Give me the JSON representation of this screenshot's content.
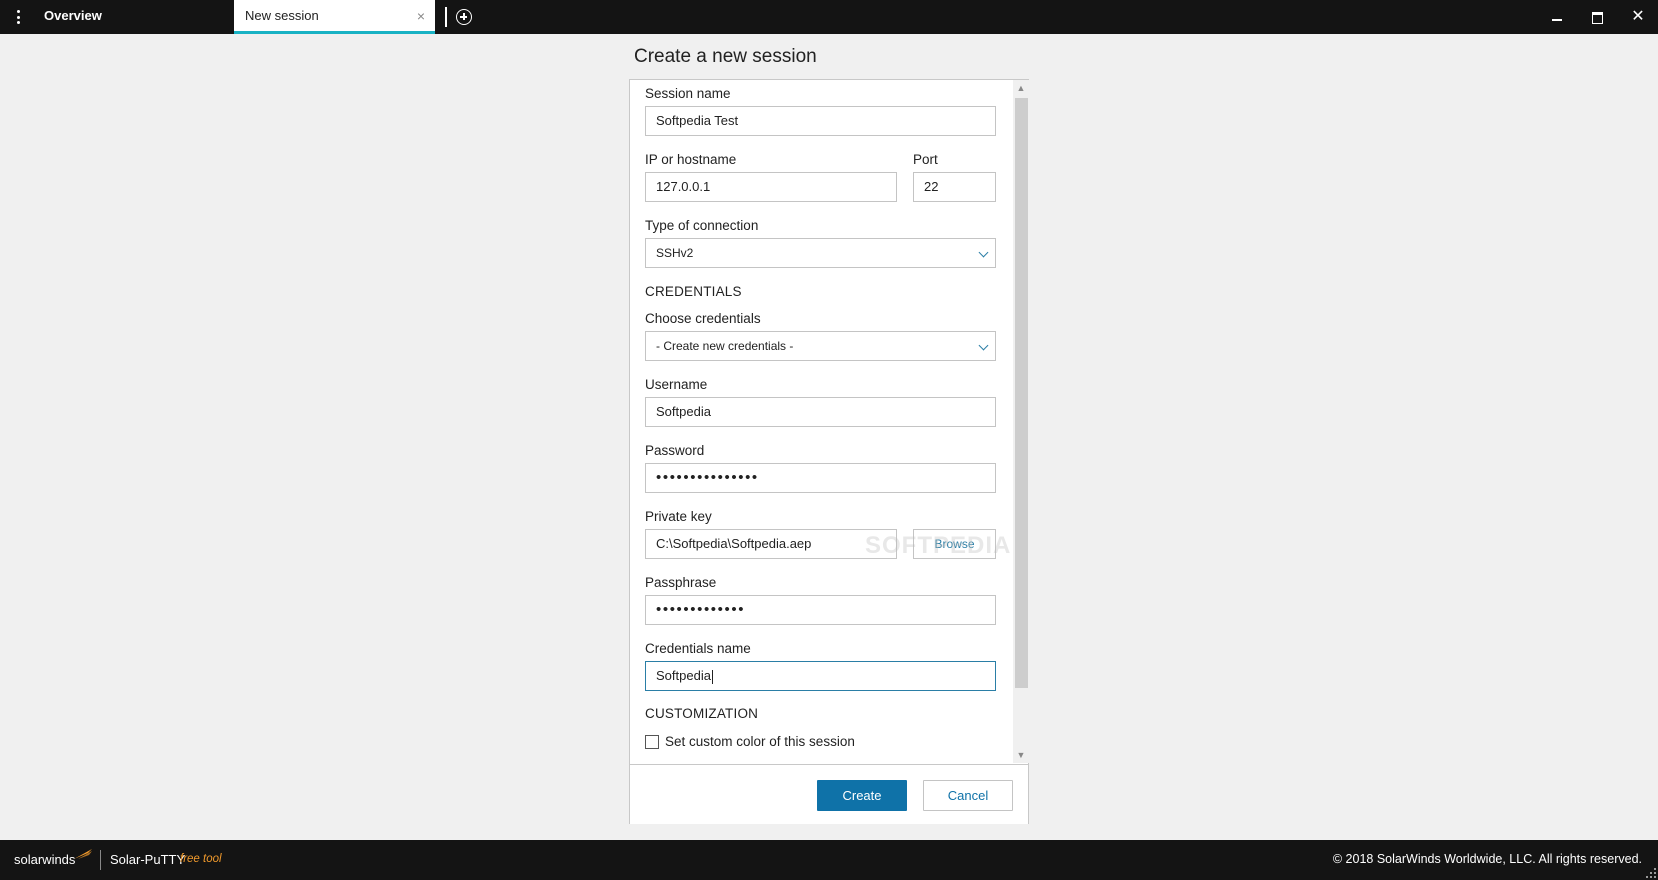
{
  "window": {
    "tabs": [
      {
        "label": "Overview"
      },
      {
        "label": "New session",
        "close": "×"
      }
    ],
    "close_glyph": "✕"
  },
  "dialog": {
    "title": "Create a new session",
    "session_name": {
      "label": "Session name",
      "value": "Softpedia Test"
    },
    "host": {
      "label": "IP or hostname",
      "value": "127.0.0.1"
    },
    "port": {
      "label": "Port",
      "value": "22"
    },
    "connection_type": {
      "label": "Type of connection",
      "value": "SSHv2"
    },
    "credentials_section": "CREDENTIALS",
    "choose_credentials": {
      "label": "Choose credentials",
      "value": "- Create new credentials -"
    },
    "username": {
      "label": "Username",
      "value": "Softpedia"
    },
    "password": {
      "label": "Password",
      "value": "•••••••••••••••"
    },
    "private_key": {
      "label": "Private key",
      "value": "C:\\Softpedia\\Softpedia.aep",
      "browse_label": "Browse"
    },
    "passphrase": {
      "label": "Passphrase",
      "value": "•••••••••••••"
    },
    "credentials_name": {
      "label": "Credentials name",
      "value": "Softpedia"
    },
    "customization_section": "CUSTOMIZATION",
    "custom_color": {
      "label": "Set custom color of this session",
      "checked": false
    },
    "create_label": "Create",
    "cancel_label": "Cancel",
    "accent_color": "#0f72a8",
    "focus_color": "#2a7ea6"
  },
  "watermark": "SOFTPEDIA",
  "footer": {
    "brand": "solarwinds",
    "product": "Solar-PuTTY",
    "free_tool": "free tool",
    "copyright": "© 2018 SolarWinds Worldwide, LLC. All rights reserved."
  },
  "icons": [
    "menu-icon",
    "add-tab-icon",
    "minimize-icon",
    "maximize-icon",
    "close-icon",
    "chevron-down-icon",
    "solarwinds-logo-icon",
    "resize-grip-icon"
  ]
}
